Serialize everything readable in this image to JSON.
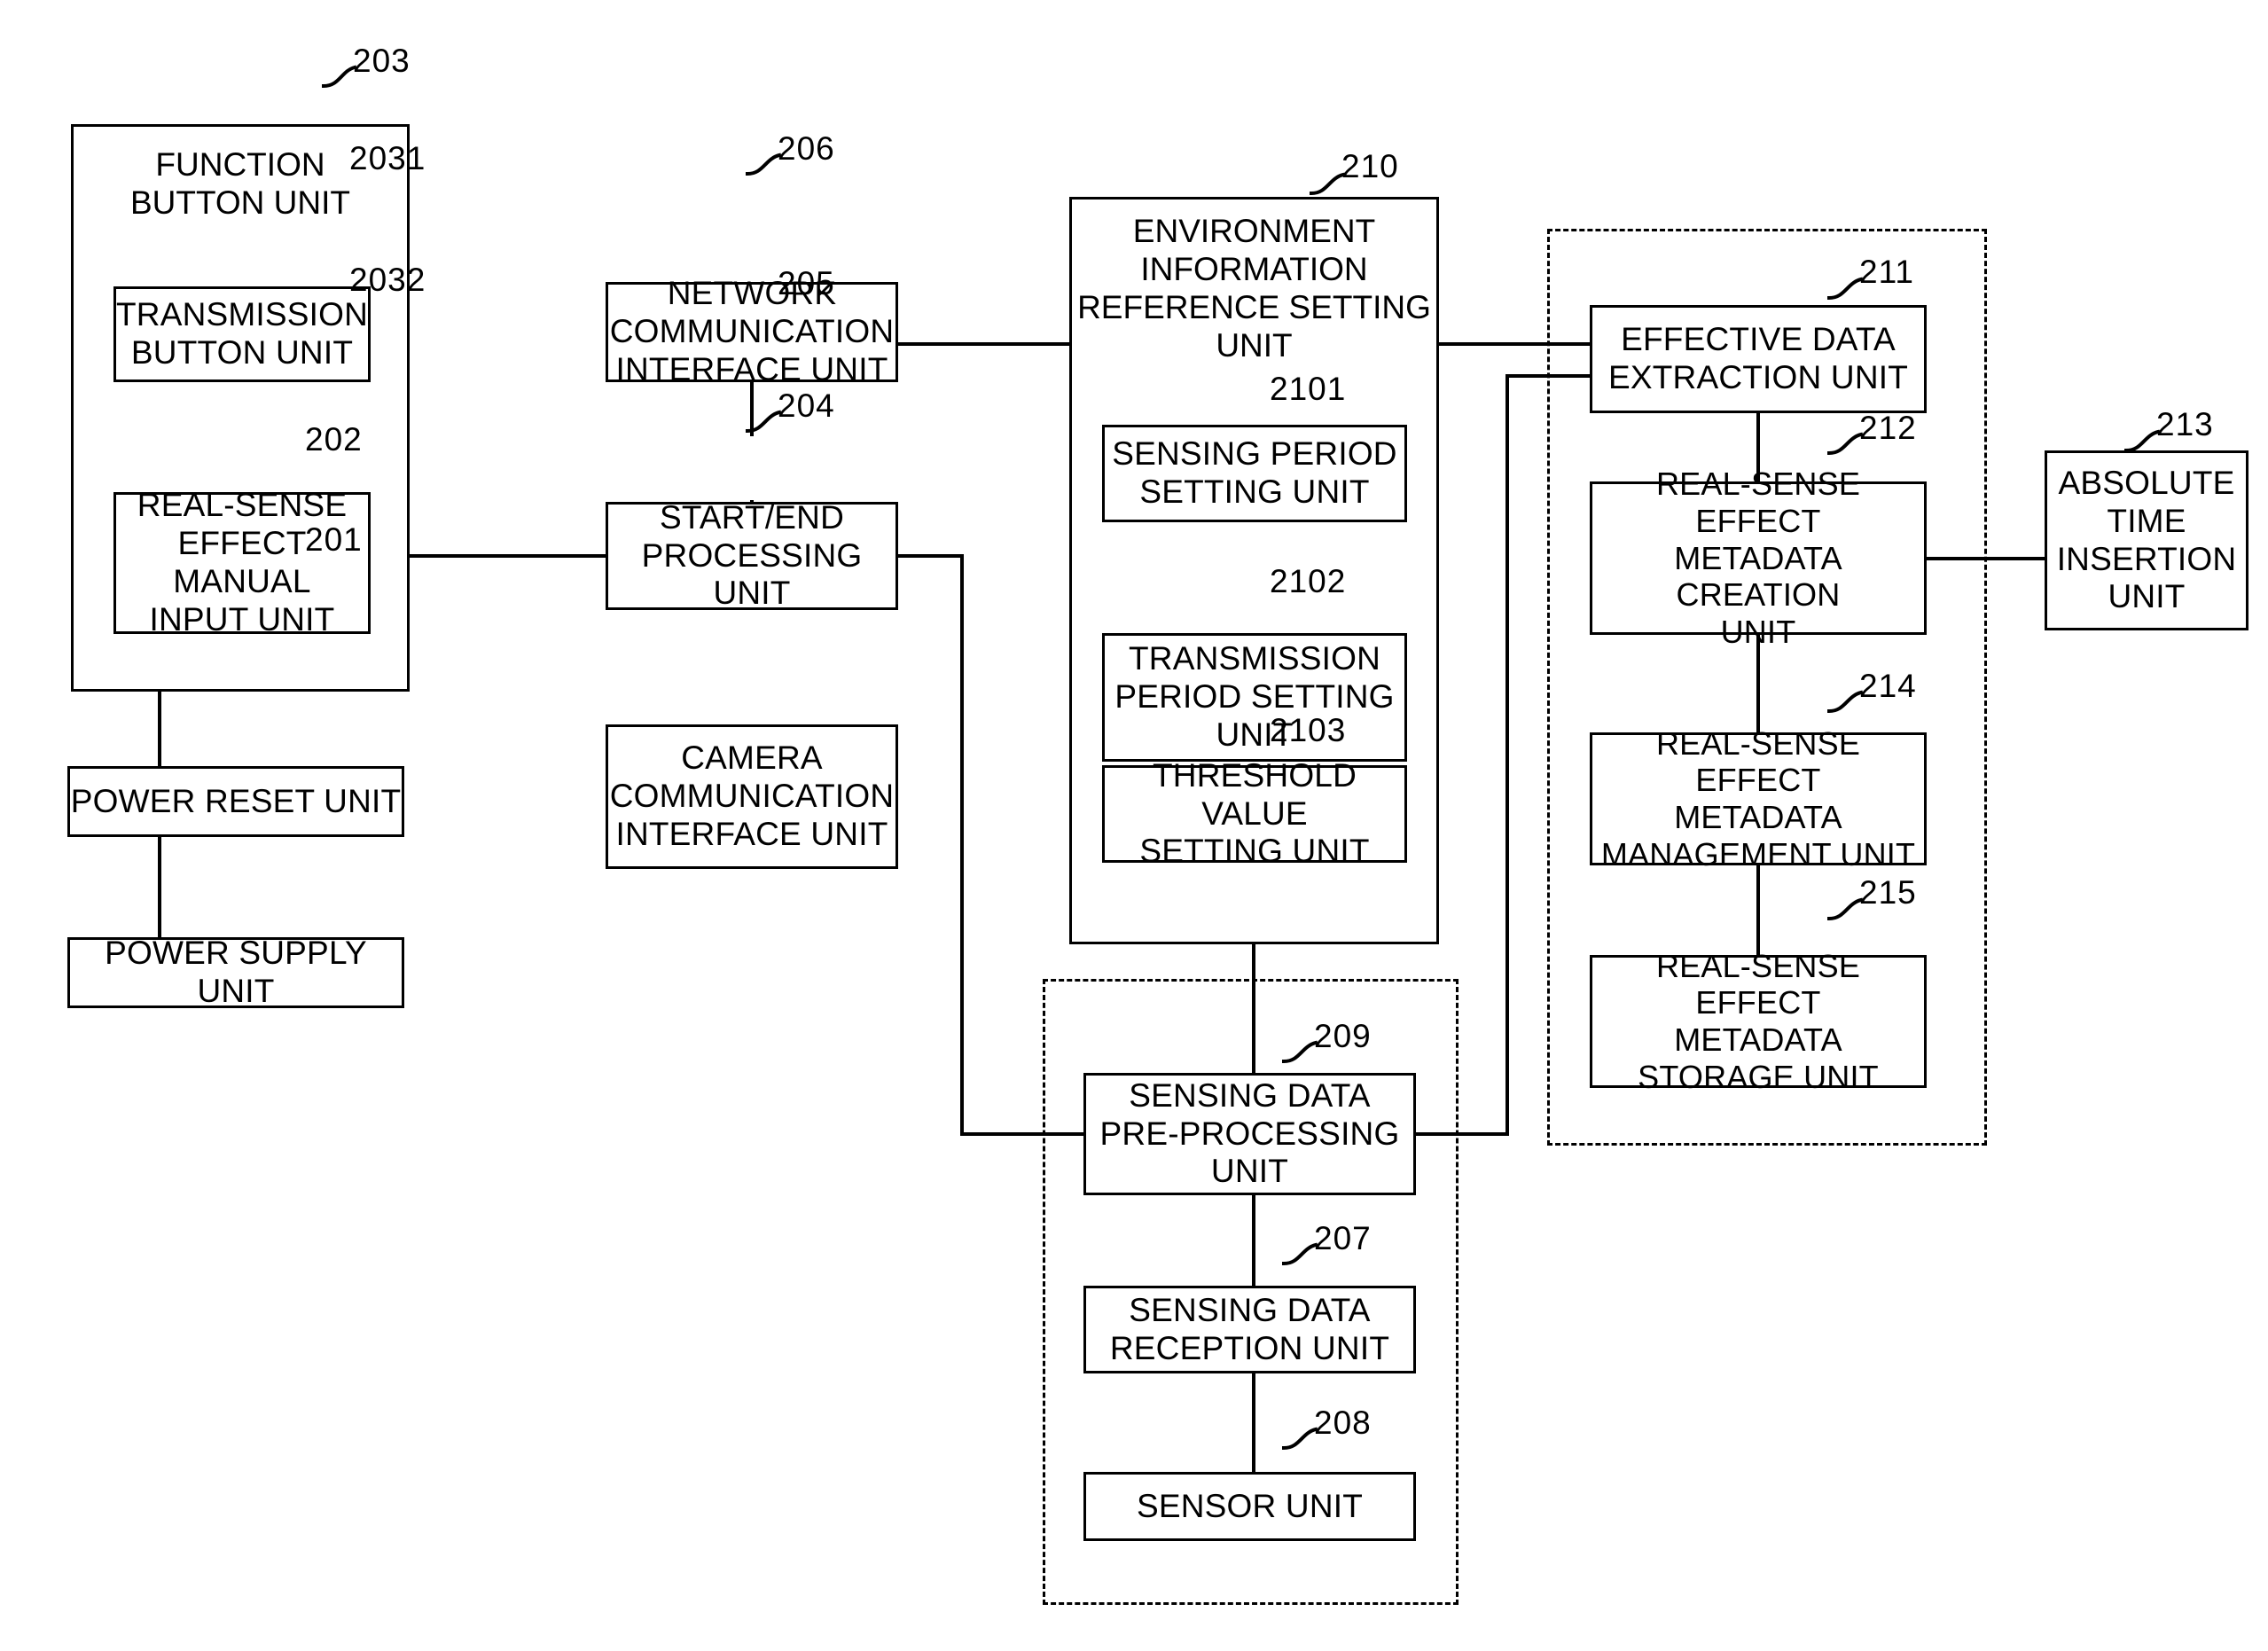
{
  "figure": {
    "type": "patent-block-diagram",
    "description": "Block diagram of a real-sense effect metadata generation apparatus"
  },
  "blocks": {
    "function_button_unit": {
      "ref": "203",
      "label": "FUNCTION\nBUTTON UNIT"
    },
    "transmission_button_unit": {
      "ref": "2031",
      "label": "TRANSMISSION\nBUTTON UNIT"
    },
    "real_sense_manual_input": {
      "ref": "2032",
      "label": "REAL-SENSE\nEFFECT MANUAL\nINPUT UNIT"
    },
    "power_reset_unit": {
      "ref": "202",
      "label": "POWER RESET UNIT"
    },
    "power_supply_unit": {
      "ref": "201",
      "label": "POWER SUPPLY UNIT"
    },
    "network_comm_interface_unit": {
      "ref": "206",
      "label": "NETWORK\nCOMMUNICATION\nINTERFACE UNIT"
    },
    "start_end_processing_unit": {
      "ref": "205",
      "label": "START/END\nPROCESSING UNIT"
    },
    "camera_comm_interface_unit": {
      "ref": "204",
      "label": "CAMERA\nCOMMUNICATION\nINTERFACE UNIT"
    },
    "env_info_reference_setting": {
      "ref": "210",
      "label": "ENVIRONMENT\nINFORMATION\nREFERENCE SETTING\nUNIT"
    },
    "sensing_period_setting_unit": {
      "ref": "2101",
      "label": "SENSING PERIOD\nSETTING UNIT"
    },
    "transmission_period_setting": {
      "ref": "2102",
      "label": "TRANSMISSION\nPERIOD SETTING\nUNIT"
    },
    "threshold_value_setting_unit": {
      "ref": "2103",
      "label": "THRESHOLD VALUE\nSETTING UNIT"
    },
    "sensing_data_preprocessing": {
      "ref": "209",
      "label": "SENSING DATA\nPRE-PROCESSING\nUNIT"
    },
    "sensing_data_reception_unit": {
      "ref": "207",
      "label": "SENSING DATA\nRECEPTION UNIT"
    },
    "sensor_unit": {
      "ref": "208",
      "label": "SENSOR UNIT"
    },
    "effective_data_extraction": {
      "ref": "211",
      "label": "EFFECTIVE DATA\nEXTRACTION UNIT"
    },
    "rs_metadata_creation_unit": {
      "ref": "212",
      "label": "REAL-SENSE EFFECT\nMETADATA CREATION\nUNIT"
    },
    "rs_metadata_management_unit": {
      "ref": "214",
      "label": "REAL-SENSE EFFECT\nMETADATA\nMANAGEMENT UNIT"
    },
    "rs_metadata_storage_unit": {
      "ref": "215",
      "label": "REAL-SENSE EFFECT\nMETADATA\nSTORAGE UNIT"
    },
    "absolute_time_insertion_unit": {
      "ref": "213",
      "label": "ABSOLUTE\nTIME\nINSERTION\nUNIT"
    }
  },
  "colors": {
    "line": "#000000",
    "background": "#ffffff",
    "text": "#000000"
  }
}
